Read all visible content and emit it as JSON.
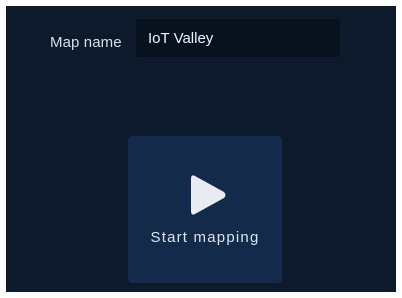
{
  "map_name": {
    "label": "Map name",
    "value": "IoT Valley",
    "placeholder": ""
  },
  "start": {
    "label": "Start mapping",
    "icon": "play-icon"
  },
  "colors": {
    "panel_bg": "#0c1a2b",
    "input_bg": "#08121f",
    "card_bg": "#132a4a",
    "text": "#d7dee8",
    "icon": "#e8ecf2"
  }
}
